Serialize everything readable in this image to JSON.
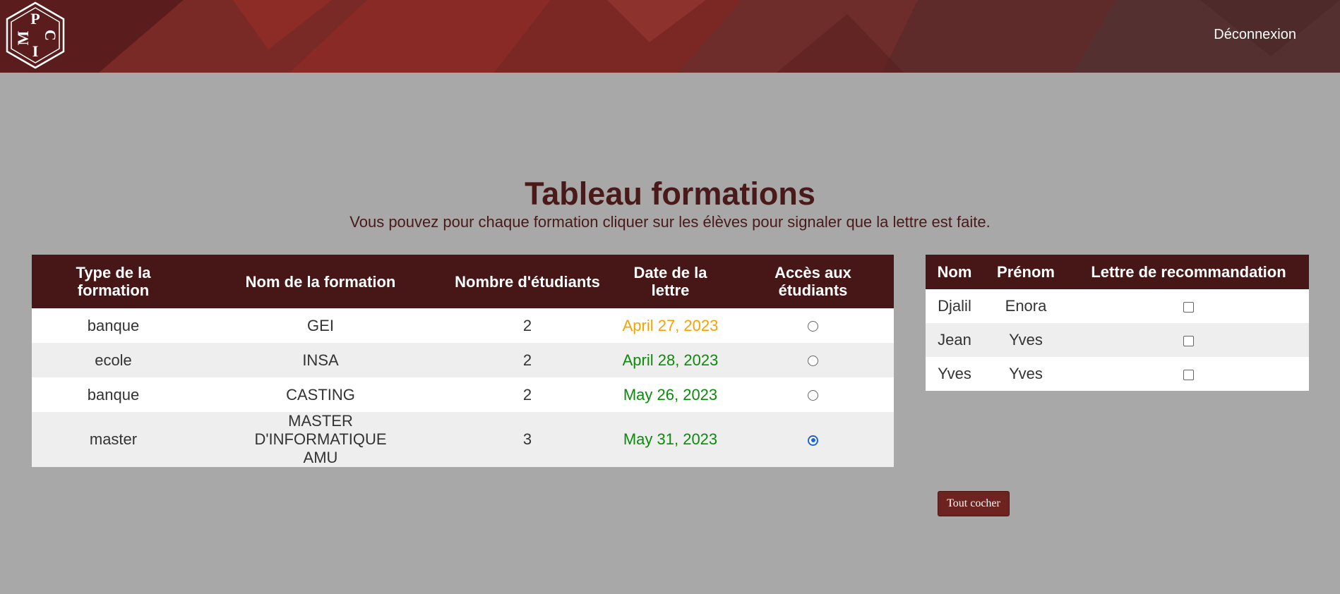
{
  "header": {
    "logo_letters": [
      "M",
      "P",
      "C",
      "I"
    ],
    "logout_label": "Déconnexion"
  },
  "main": {
    "title": "Tableau formations",
    "subtitle": "Vous pouvez pour chaque formation cliquer sur les élèves pour signaler que la lettre est faite."
  },
  "formations_table": {
    "headers": [
      "Type de la formation",
      "Nom de la formation",
      "Nombre d'étudiants",
      "Date de la lettre",
      "Accès aux étudiants"
    ],
    "rows": [
      {
        "type": "banque",
        "name": "GEI",
        "count": "2",
        "date": "April 27, 2023",
        "date_color": "#f5a300",
        "selected": false
      },
      {
        "type": "ecole",
        "name": "INSA",
        "count": "2",
        "date": "April 28, 2023",
        "date_color": "#0c8a0c",
        "selected": false
      },
      {
        "type": "banque",
        "name": "CASTING",
        "count": "2",
        "date": "May 26, 2023",
        "date_color": "#0c8a0c",
        "selected": false
      },
      {
        "type": "master",
        "name": "MASTER D'INFORMATIQUE AMU",
        "count": "3",
        "date": "May 31, 2023",
        "date_color": "#0c8a0c",
        "selected": true
      }
    ]
  },
  "students_table": {
    "headers": [
      "Nom",
      "Prénom",
      "Lettre de recommandation"
    ],
    "rows": [
      {
        "nom": "Djalil",
        "prenom": "Enora",
        "checked": false
      },
      {
        "nom": "Jean",
        "prenom": "Yves",
        "checked": false
      },
      {
        "nom": "Yves",
        "prenom": "Yves",
        "checked": false
      }
    ]
  },
  "actions": {
    "check_all_label": "Tout cocher"
  },
  "colors": {
    "header_bg": "#6b2a27",
    "table_header_bg": "#471717",
    "title_color": "#4a1919",
    "page_bg": "#a8a8a8",
    "radio_selected": "#1a66d6"
  }
}
